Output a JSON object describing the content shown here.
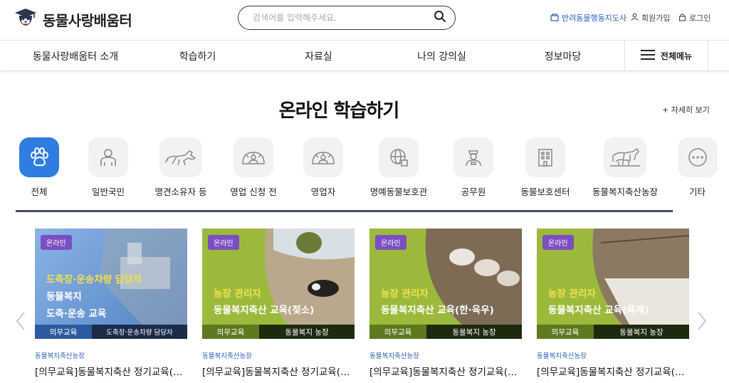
{
  "header": {
    "logo_text": "동물사랑배움터",
    "search_placeholder": "검색어를 입력해주세요.",
    "util_map": "반려동물행동지도사",
    "util_join": "회원가입",
    "util_login": "로그인"
  },
  "nav": {
    "items": [
      {
        "label": "동물사랑배움터 소개"
      },
      {
        "label": "학습하기"
      },
      {
        "label": "자료실"
      },
      {
        "label": "나의 강의실"
      },
      {
        "label": "정보마당"
      }
    ],
    "all_menu": "전체메뉴"
  },
  "section": {
    "title": "온라인 학습하기",
    "more": "+ 자세히 보기"
  },
  "categories": [
    {
      "label": "전체",
      "icon": "paw-icon",
      "active": true
    },
    {
      "label": "일반국민",
      "icon": "person-icon"
    },
    {
      "label": "맹견소유자 등",
      "icon": "dog-icon"
    },
    {
      "label": "영업 신청 전",
      "icon": "sun-person-icon"
    },
    {
      "label": "영업자",
      "icon": "sun-person-icon"
    },
    {
      "label": "명예동물보호관",
      "icon": "globe-icon"
    },
    {
      "label": "공무원",
      "icon": "officer-icon"
    },
    {
      "label": "동물보호센터",
      "icon": "building-icon"
    },
    {
      "label": "동물복지축산농장",
      "icon": "farm-animals-icon"
    },
    {
      "label": "기타",
      "icon": "more-icon"
    }
  ],
  "scroll_progress": 0.999,
  "cards": [
    {
      "badge": "온라인",
      "line1": "도축장·운송차량 담당자",
      "line2": "동물복지",
      "line3": "도축·운송 교육",
      "bar_left": "의무교육",
      "bar_right": "도축장·운송차량 담당자",
      "category": "동물복지축산농장",
      "title": "[의무교육]동물복지축산 정기교육(도축·운송)",
      "bg": "#6f9fd8"
    },
    {
      "badge": "온라인",
      "line1": "농장 관리자",
      "line2": "동물복지축산 교육(젖소)",
      "line3": "",
      "bar_left": "의무교육",
      "bar_right": "동물복지 농장",
      "category": "동물복지축산농장",
      "title": "[의무교육]동물복지축산 정기교육(젖소)",
      "bg": "#9bba3c"
    },
    {
      "badge": "온라인",
      "line1": "농장 관리자",
      "line2": "동물복지축산 교육(한·육우)",
      "line3": "",
      "bar_left": "의무교육",
      "bar_right": "동물복지 농장",
      "category": "동물복지축산농장",
      "title": "[의무교육]동물복지축산 정기교육(한·육우)",
      "bg": "#9bba3c"
    },
    {
      "badge": "온라인",
      "line1": "농장 관리자",
      "line2": "동물복지축산 교육(육계)",
      "line3": "",
      "bar_left": "의무교육",
      "bar_right": "동물복지 농장",
      "category": "동물복지축산농장",
      "title": "[의무교육]동물복지축산 정기교육(육계)",
      "bg": "#9bba3c"
    }
  ],
  "colors": {
    "accent": "#2f7de1",
    "brand_navy": "#2a3550",
    "badge": "#7b4fc0",
    "highlight_yellow": "#f3e04a",
    "link_blue": "#2b5fb5"
  }
}
